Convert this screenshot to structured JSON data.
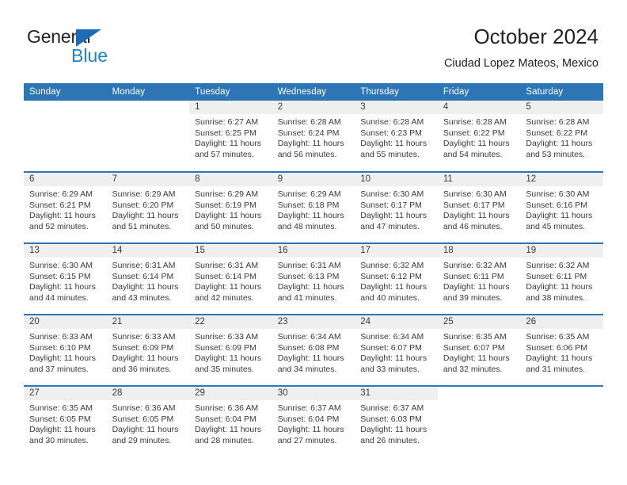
{
  "brand": {
    "name_top": "General",
    "name_bottom": "Blue",
    "accent_color": "#1b84d1",
    "triangle_color": "#1d6cb3"
  },
  "header": {
    "title": "October 2024",
    "subtitle": "Ciudad Lopez Mateos, Mexico"
  },
  "theme": {
    "header_row_bg": "#2e75b6",
    "header_row_text": "#ffffff",
    "daynum_band_bg": "#efefef",
    "cell_text": "#3a3a3a",
    "week_divider": "#2e75b6"
  },
  "weekday_headers": [
    "Sunday",
    "Monday",
    "Tuesday",
    "Wednesday",
    "Thursday",
    "Friday",
    "Saturday"
  ],
  "labels": {
    "sunrise_prefix": "Sunrise:",
    "sunset_prefix": "Sunset:",
    "daylight_prefix": "Daylight:"
  },
  "weeks": [
    [
      {
        "day": "",
        "sunrise": "",
        "sunset": "",
        "daylight": ""
      },
      {
        "day": "",
        "sunrise": "",
        "sunset": "",
        "daylight": ""
      },
      {
        "day": "1",
        "sunrise": "Sunrise: 6:27 AM",
        "sunset": "Sunset: 6:25 PM",
        "daylight": "Daylight: 11 hours and 57 minutes."
      },
      {
        "day": "2",
        "sunrise": "Sunrise: 6:28 AM",
        "sunset": "Sunset: 6:24 PM",
        "daylight": "Daylight: 11 hours and 56 minutes."
      },
      {
        "day": "3",
        "sunrise": "Sunrise: 6:28 AM",
        "sunset": "Sunset: 6:23 PM",
        "daylight": "Daylight: 11 hours and 55 minutes."
      },
      {
        "day": "4",
        "sunrise": "Sunrise: 6:28 AM",
        "sunset": "Sunset: 6:22 PM",
        "daylight": "Daylight: 11 hours and 54 minutes."
      },
      {
        "day": "5",
        "sunrise": "Sunrise: 6:28 AM",
        "sunset": "Sunset: 6:22 PM",
        "daylight": "Daylight: 11 hours and 53 minutes."
      }
    ],
    [
      {
        "day": "6",
        "sunrise": "Sunrise: 6:29 AM",
        "sunset": "Sunset: 6:21 PM",
        "daylight": "Daylight: 11 hours and 52 minutes."
      },
      {
        "day": "7",
        "sunrise": "Sunrise: 6:29 AM",
        "sunset": "Sunset: 6:20 PM",
        "daylight": "Daylight: 11 hours and 51 minutes."
      },
      {
        "day": "8",
        "sunrise": "Sunrise: 6:29 AM",
        "sunset": "Sunset: 6:19 PM",
        "daylight": "Daylight: 11 hours and 50 minutes."
      },
      {
        "day": "9",
        "sunrise": "Sunrise: 6:29 AM",
        "sunset": "Sunset: 6:18 PM",
        "daylight": "Daylight: 11 hours and 48 minutes."
      },
      {
        "day": "10",
        "sunrise": "Sunrise: 6:30 AM",
        "sunset": "Sunset: 6:17 PM",
        "daylight": "Daylight: 11 hours and 47 minutes."
      },
      {
        "day": "11",
        "sunrise": "Sunrise: 6:30 AM",
        "sunset": "Sunset: 6:17 PM",
        "daylight": "Daylight: 11 hours and 46 minutes."
      },
      {
        "day": "12",
        "sunrise": "Sunrise: 6:30 AM",
        "sunset": "Sunset: 6:16 PM",
        "daylight": "Daylight: 11 hours and 45 minutes."
      }
    ],
    [
      {
        "day": "13",
        "sunrise": "Sunrise: 6:30 AM",
        "sunset": "Sunset: 6:15 PM",
        "daylight": "Daylight: 11 hours and 44 minutes."
      },
      {
        "day": "14",
        "sunrise": "Sunrise: 6:31 AM",
        "sunset": "Sunset: 6:14 PM",
        "daylight": "Daylight: 11 hours and 43 minutes."
      },
      {
        "day": "15",
        "sunrise": "Sunrise: 6:31 AM",
        "sunset": "Sunset: 6:14 PM",
        "daylight": "Daylight: 11 hours and 42 minutes."
      },
      {
        "day": "16",
        "sunrise": "Sunrise: 6:31 AM",
        "sunset": "Sunset: 6:13 PM",
        "daylight": "Daylight: 11 hours and 41 minutes."
      },
      {
        "day": "17",
        "sunrise": "Sunrise: 6:32 AM",
        "sunset": "Sunset: 6:12 PM",
        "daylight": "Daylight: 11 hours and 40 minutes."
      },
      {
        "day": "18",
        "sunrise": "Sunrise: 6:32 AM",
        "sunset": "Sunset: 6:11 PM",
        "daylight": "Daylight: 11 hours and 39 minutes."
      },
      {
        "day": "19",
        "sunrise": "Sunrise: 6:32 AM",
        "sunset": "Sunset: 6:11 PM",
        "daylight": "Daylight: 11 hours and 38 minutes."
      }
    ],
    [
      {
        "day": "20",
        "sunrise": "Sunrise: 6:33 AM",
        "sunset": "Sunset: 6:10 PM",
        "daylight": "Daylight: 11 hours and 37 minutes."
      },
      {
        "day": "21",
        "sunrise": "Sunrise: 6:33 AM",
        "sunset": "Sunset: 6:09 PM",
        "daylight": "Daylight: 11 hours and 36 minutes."
      },
      {
        "day": "22",
        "sunrise": "Sunrise: 6:33 AM",
        "sunset": "Sunset: 6:09 PM",
        "daylight": "Daylight: 11 hours and 35 minutes."
      },
      {
        "day": "23",
        "sunrise": "Sunrise: 6:34 AM",
        "sunset": "Sunset: 6:08 PM",
        "daylight": "Daylight: 11 hours and 34 minutes."
      },
      {
        "day": "24",
        "sunrise": "Sunrise: 6:34 AM",
        "sunset": "Sunset: 6:07 PM",
        "daylight": "Daylight: 11 hours and 33 minutes."
      },
      {
        "day": "25",
        "sunrise": "Sunrise: 6:35 AM",
        "sunset": "Sunset: 6:07 PM",
        "daylight": "Daylight: 11 hours and 32 minutes."
      },
      {
        "day": "26",
        "sunrise": "Sunrise: 6:35 AM",
        "sunset": "Sunset: 6:06 PM",
        "daylight": "Daylight: 11 hours and 31 minutes."
      }
    ],
    [
      {
        "day": "27",
        "sunrise": "Sunrise: 6:35 AM",
        "sunset": "Sunset: 6:05 PM",
        "daylight": "Daylight: 11 hours and 30 minutes."
      },
      {
        "day": "28",
        "sunrise": "Sunrise: 6:36 AM",
        "sunset": "Sunset: 6:05 PM",
        "daylight": "Daylight: 11 hours and 29 minutes."
      },
      {
        "day": "29",
        "sunrise": "Sunrise: 6:36 AM",
        "sunset": "Sunset: 6:04 PM",
        "daylight": "Daylight: 11 hours and 28 minutes."
      },
      {
        "day": "30",
        "sunrise": "Sunrise: 6:37 AM",
        "sunset": "Sunset: 6:04 PM",
        "daylight": "Daylight: 11 hours and 27 minutes."
      },
      {
        "day": "31",
        "sunrise": "Sunrise: 6:37 AM",
        "sunset": "Sunset: 6:03 PM",
        "daylight": "Daylight: 11 hours and 26 minutes."
      },
      {
        "day": "",
        "sunrise": "",
        "sunset": "",
        "daylight": ""
      },
      {
        "day": "",
        "sunrise": "",
        "sunset": "",
        "daylight": ""
      }
    ]
  ]
}
